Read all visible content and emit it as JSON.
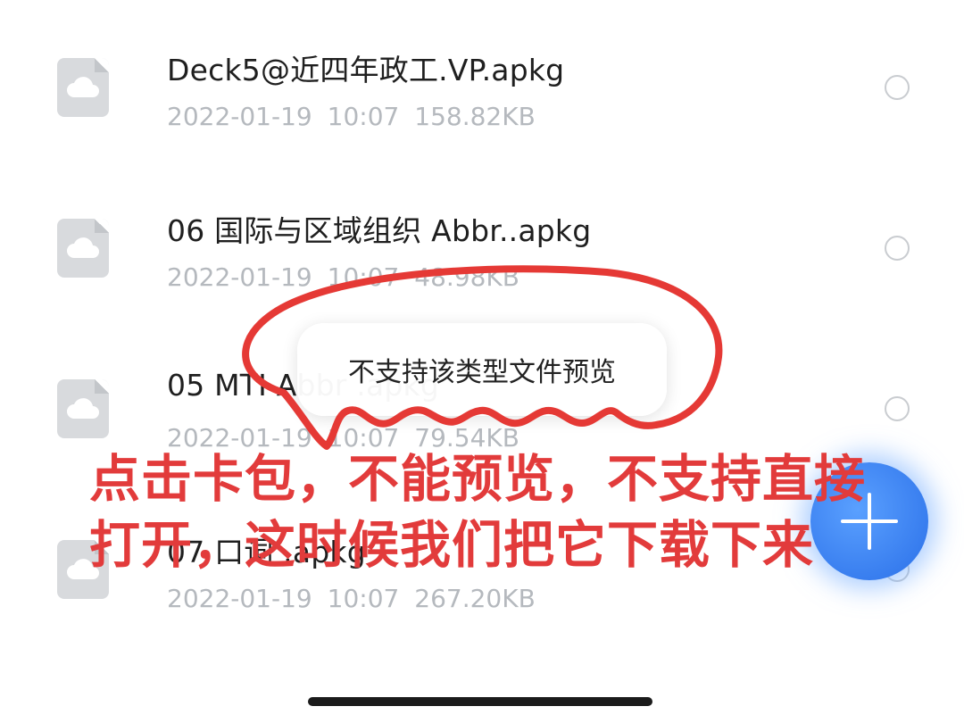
{
  "files": [
    {
      "name": "Deck5@近四年政工.VP.apkg",
      "date": "2022-01-19",
      "time": "10:07",
      "size": "158.82KB"
    },
    {
      "name": "06 国际与区域组织 Abbr..apkg",
      "date": "2022-01-19",
      "time": "10:07",
      "size": "48.98KB"
    },
    {
      "name": "05 MTI Abbr .apkg",
      "date": "2022-01-19",
      "time": "10:07",
      "size": "79.54KB"
    },
    {
      "name": "07 口词 .apkg",
      "date": "2022-01-19",
      "time": "10:07",
      "size": "267.20KB"
    }
  ],
  "toast": {
    "message": "不支持该类型文件预览"
  },
  "annotation": {
    "caption": "点击卡包，不能预览，不支持直接打开，这时候我们把它下载下来",
    "color": "#e23b3b"
  },
  "icons": {
    "file": "cloud-file-icon",
    "fab": "plus-icon"
  }
}
